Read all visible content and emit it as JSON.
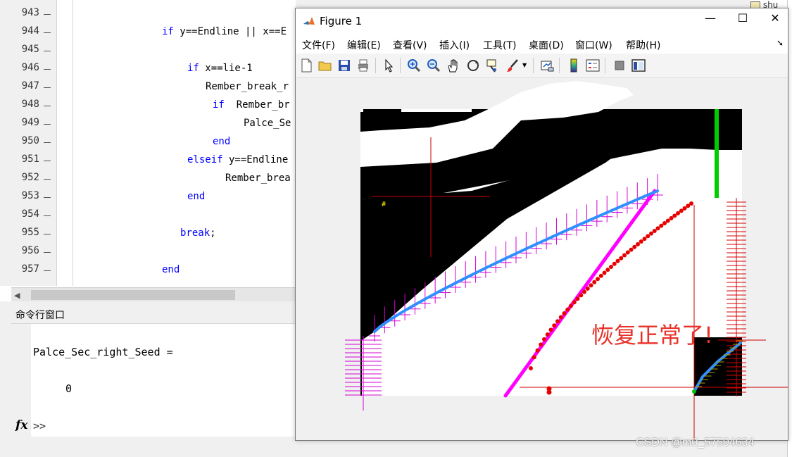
{
  "editor": {
    "line_numbers": [
      "943",
      "944",
      "945",
      "946",
      "947",
      "948",
      "949",
      "950",
      "951",
      "952",
      "953",
      "954",
      "955",
      "956",
      "957"
    ],
    "lines": [
      {
        "kw": "",
        "text": ""
      },
      {
        "kw": "if",
        "text": " y==Endline || x==E"
      },
      {
        "kw": "",
        "text": ""
      },
      {
        "kw": "if",
        "text": " x==lie-1"
      },
      {
        "kw": "",
        "text": "Rember_break_r"
      },
      {
        "kw": "if",
        "text": "  Rember_br"
      },
      {
        "kw": "",
        "text": "Palce_Se"
      },
      {
        "kw": "end",
        "text": ""
      },
      {
        "kw": "elseif",
        "text": " y==Endline"
      },
      {
        "kw": "",
        "text": "Rember_brea"
      },
      {
        "kw": "end",
        "text": ""
      },
      {
        "kw": "",
        "text": ""
      },
      {
        "kw": "break",
        "text": ";"
      },
      {
        "kw": "",
        "text": ""
      },
      {
        "kw": "end",
        "text": ""
      }
    ]
  },
  "command_window": {
    "title": "命令行窗口",
    "output_var": "Palce_Sec_right_Seed =",
    "output_val": "0",
    "prompt": ">>"
  },
  "right_panel": {
    "folder_name": "shu"
  },
  "figure": {
    "title": "Figure 1",
    "window_buttons": {
      "minimize": "—",
      "maximize": "☐",
      "close": "✕"
    },
    "menu": [
      "文件(F)",
      "编辑(E)",
      "查看(V)",
      "插入(I)",
      "工具(T)",
      "桌面(D)",
      "窗口(W)",
      "帮助(H)"
    ],
    "annotation": "恢复正常了!",
    "colors": {
      "plus_markers": "#d400d4",
      "blue_line": "#2f8fff",
      "magenta_line": "#ff00ff",
      "red_dots": "#e60000",
      "green_bar": "#00cc00",
      "annotation_text": "#e8322a"
    }
  },
  "watermark": "CSDN @m0_57504634"
}
